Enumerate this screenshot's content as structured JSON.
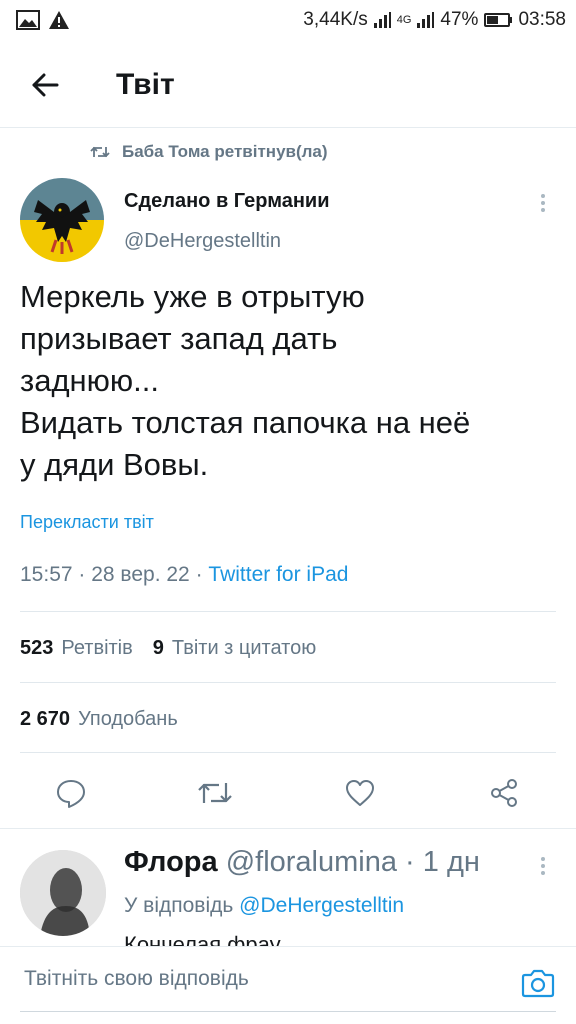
{
  "status_bar": {
    "speed": "3,44K/s",
    "network": "4G",
    "battery_percent": "47%",
    "battery_level": 0.47,
    "time": "03:58"
  },
  "header": {
    "title": "Твіт",
    "back_icon": "arrow-left-icon"
  },
  "retweet": {
    "text": "Баба Тома ретвітнув(ла)",
    "icon": "retweet-icon"
  },
  "tweet": {
    "author_name": "Сделано в Германии",
    "author_handle": "@DeHergestelltin",
    "text": "Меркель уже в отрытую\nпризывает запад дать\nзаднюю...\nВидать толстая папочка на неё\nу дяди Вовы.",
    "translate": "Перекласти твіт",
    "time": "15:57",
    "date": "28 вер. 22",
    "source": "Twitter for iPad",
    "retweets_count": "523",
    "retweets_label": "Ретвітів",
    "quotes_count": "9",
    "quotes_label": "Твіти з цитатою",
    "likes_count": "2 670",
    "likes_label": "Уподобань"
  },
  "actions": [
    "reply-icon",
    "retweet-icon",
    "like-icon",
    "share-icon"
  ],
  "reply": {
    "name": "Флора",
    "handle": "@floralumina",
    "time": "1 дн",
    "replying_to_label": "У відповідь",
    "replying_to_handle": "@DeHergestelltin",
    "text": "Кончелая фрау"
  },
  "compose": {
    "placeholder": "Твітніть свою відповідь",
    "camera_icon": "camera-icon"
  },
  "colors": {
    "accent": "#1b95e0",
    "secondary_text": "#657786",
    "divider": "#e1e8ed"
  }
}
